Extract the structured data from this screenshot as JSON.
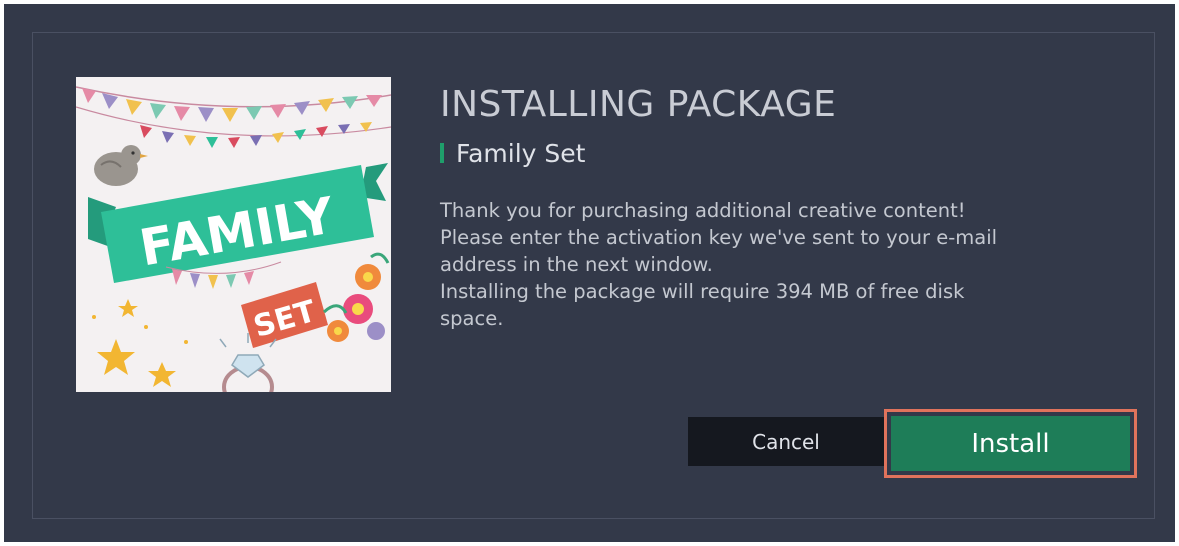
{
  "dialog": {
    "title": "INSTALLING PACKAGE",
    "package_name": "Family Set",
    "description": [
      "Thank you for purchasing additional creative content!",
      "Please enter the activation key we've sent to your e-mail",
      "address in the next window.",
      "Installing the package will require 394 MB of free disk",
      "space."
    ]
  },
  "thumbnail": {
    "word_top": "FAMILY",
    "word_bottom": "SET"
  },
  "buttons": {
    "cancel_label": "Cancel",
    "install_label": "Install"
  },
  "colors": {
    "background": "#333949",
    "accent": "#1e7d58",
    "highlight": "#e0735c",
    "ribbon": "#2ebf98",
    "tag": "#e0624a"
  }
}
